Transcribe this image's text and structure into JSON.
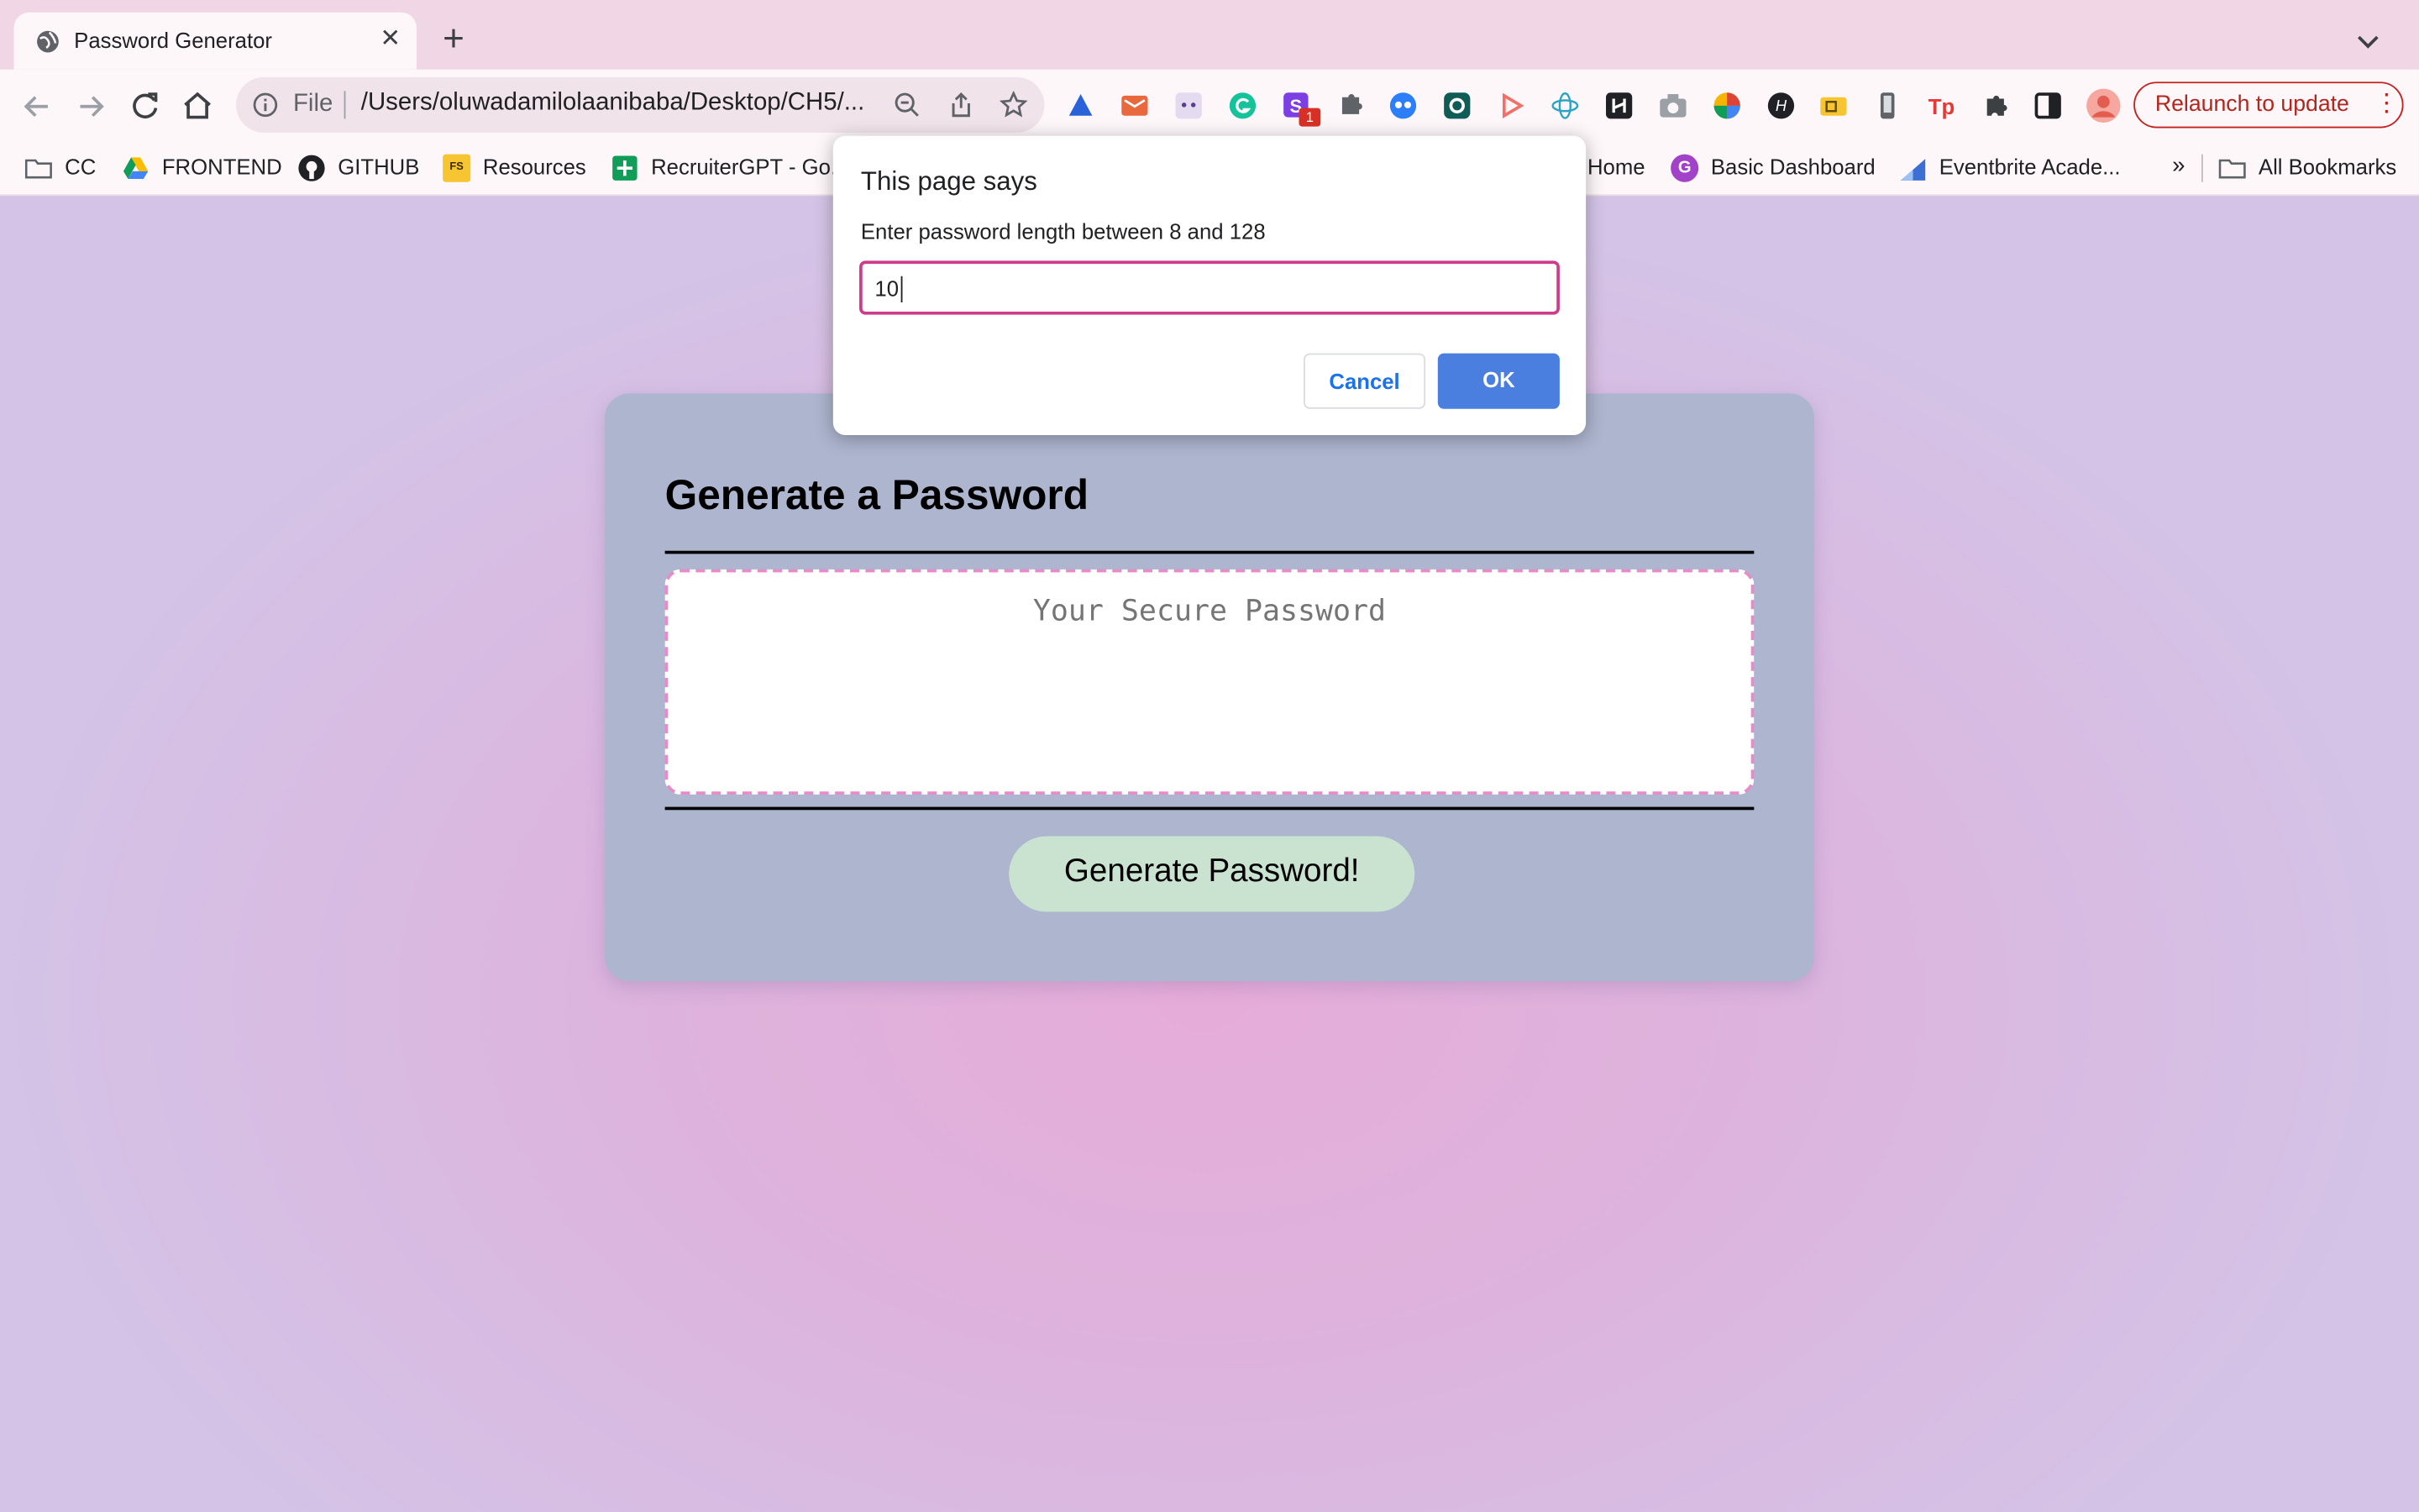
{
  "browser": {
    "tab": {
      "title": "Password Generator",
      "close": "✕"
    },
    "new_tab": "+",
    "omnibox": {
      "scheme": "File",
      "url": "/Users/oluwadamilolaanibaba/Desktop/CH5/..."
    },
    "relaunch": {
      "label": "Relaunch to update",
      "menu": "⋮"
    },
    "extension_badge": "1",
    "bookmarks": [
      {
        "label": "CC",
        "icon": "folder-icon"
      },
      {
        "label": "FRONTEND",
        "icon": "drive-icon"
      },
      {
        "label": "GITHUB",
        "icon": "github-icon"
      },
      {
        "label": "Resources",
        "icon": "fs-icon",
        "icon_text": "FS"
      },
      {
        "label": "RecruiterGPT - Go...",
        "icon": "sheets-icon"
      },
      {
        "label": "Home",
        "icon": ""
      },
      {
        "label": "Basic Dashboard",
        "icon": "g-icon",
        "icon_text": "G"
      },
      {
        "label": "Eventbrite Acade...",
        "icon": "eventbrite-icon"
      },
      {
        "label": "»",
        "icon": ""
      },
      {
        "label": "All Bookmarks",
        "icon": "folder-icon"
      }
    ]
  },
  "page": {
    "title": "Generate a Password",
    "password_placeholder": "Your Secure Password",
    "generate_button": "Generate Password!"
  },
  "dialog": {
    "title": "This page says",
    "message": "Enter password length between 8 and 128",
    "input_value": "10",
    "cancel": "Cancel",
    "ok": "OK"
  },
  "colors": {
    "accent": "#4a7fe0",
    "card": "#adb5cf",
    "button": "#c9e3d0",
    "input_border": "#cf3b8b",
    "relaunch": "#b3261e"
  }
}
